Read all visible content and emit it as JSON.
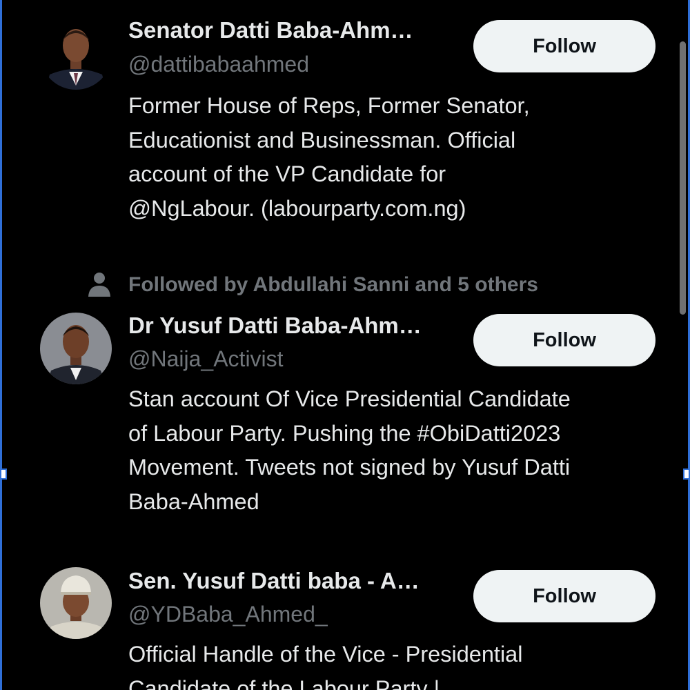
{
  "follow_label": "Follow",
  "social_context": "Followed by Abdullahi Sanni and 5 others",
  "users": [
    {
      "name": "Senator Datti Baba-Ahm…",
      "handle": "@dattibabaahmed",
      "bio": [
        "Former House of Reps, Former Senator,",
        "Educationist and Businessman. Official",
        "account of the VP Candidate for",
        "@NgLabour. (labourparty.com.ng)"
      ]
    },
    {
      "name": "Dr Yusuf Datti Baba-Ahm…",
      "handle": "@Naija_Activist",
      "bio": [
        "Stan account Of Vice Presidential Candidate",
        "of Labour Party. Pushing the #ObiDatti2023",
        "Movement. Tweets not signed by Yusuf Datti",
        "Baba-Ahmed"
      ]
    },
    {
      "name": "Sen. Yusuf Datti baba - A…",
      "handle": "@YDBaba_Ahmed_",
      "bio": [
        "Official Handle of the Vice - Presidential",
        "Candidate of the Labour Party |"
      ]
    }
  ],
  "colors": {
    "background": "#000000",
    "primary_text": "#e7e9ea",
    "secondary_text": "#71767b",
    "button_bg": "#eff3f4",
    "button_text": "#0f1419",
    "selection_accent": "#2f6fd8"
  }
}
